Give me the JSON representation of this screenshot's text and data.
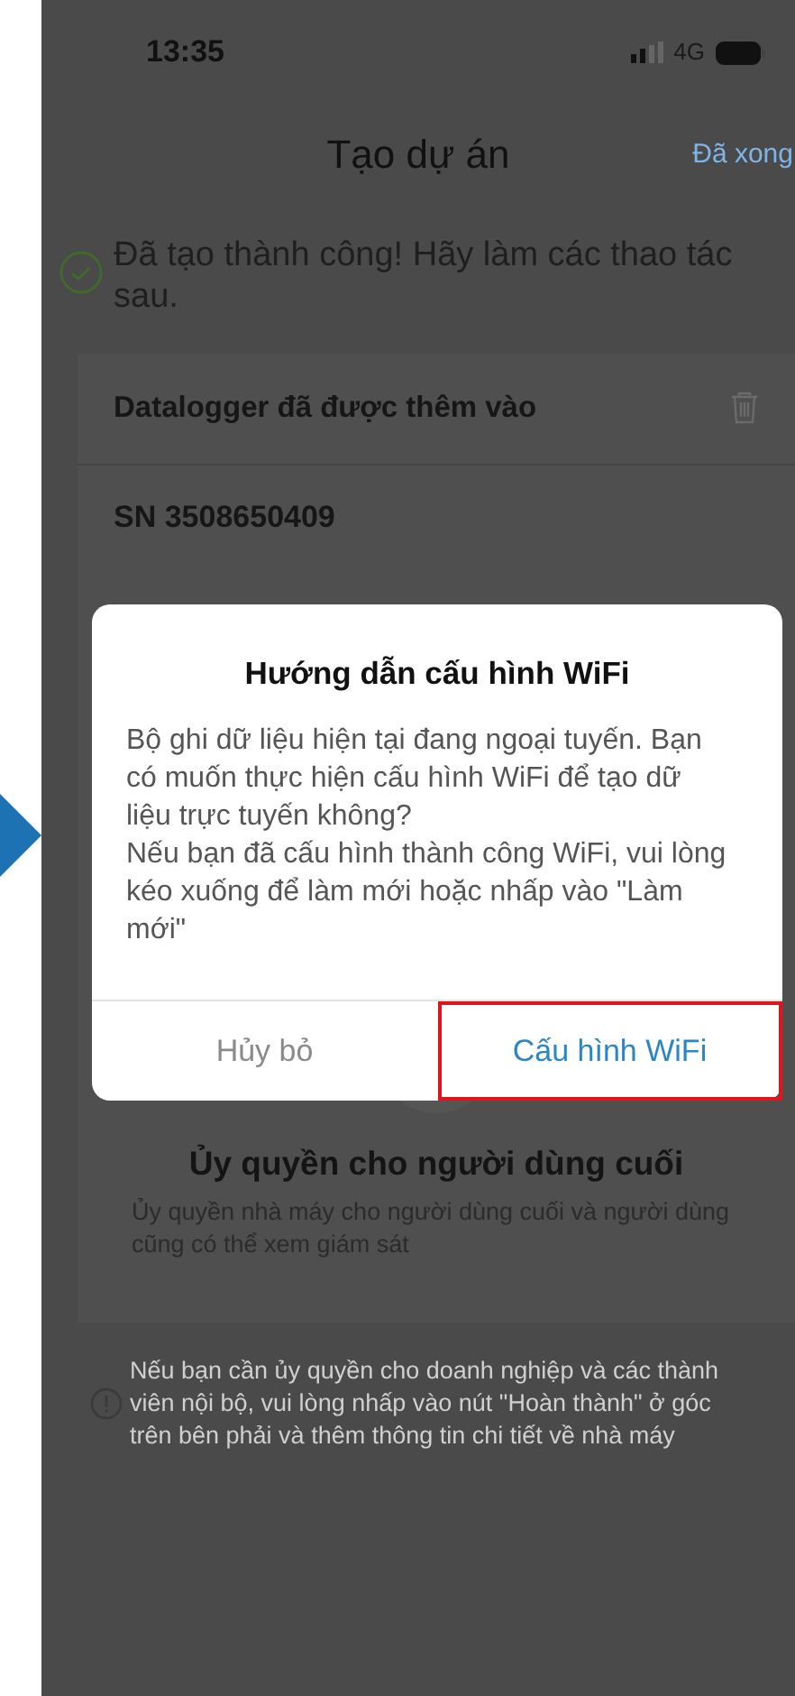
{
  "status_bar": {
    "time": "13:35",
    "network": "4G"
  },
  "header": {
    "title": "Tạo dự án",
    "action": "Đã xong"
  },
  "success_message": "Đã tạo thành công! Hãy làm các thao tác sau.",
  "datalogger_card": {
    "title": "Datalogger đã được thêm vào",
    "serial": "SN 3508650409"
  },
  "authorization": {
    "title": "Ủy quyền cho người dùng cuối",
    "description": "Ủy quyền nhà máy cho người dùng cuối và người dùng cũng có thể xem giám sát"
  },
  "note": "Nếu bạn cần ủy quyền cho doanh nghiệp và các thành viên nội bộ, vui lòng nhấp vào nút \"Hoàn thành\" ở góc trên bên phải và thêm thông tin chi tiết về nhà máy",
  "dialog": {
    "title": "Hướng dẫn cấu hình WiFi",
    "message": [
      "Bộ ghi dữ liệu hiện tại đang ngoại tuyến. Bạn có muốn thực hiện cấu hình WiFi để tạo dữ liệu trực tuyến không?",
      "Nếu bạn đã cấu hình thành công WiFi, vui lòng kéo xuống để làm mới hoặc nhấp vào \"Làm mới\""
    ],
    "buttons": [
      {
        "label": "Hủy bỏ",
        "primary": false,
        "highlighted": false
      },
      {
        "label": "Cấu hình WiFi",
        "primary": true,
        "highlighted": true
      }
    ]
  }
}
